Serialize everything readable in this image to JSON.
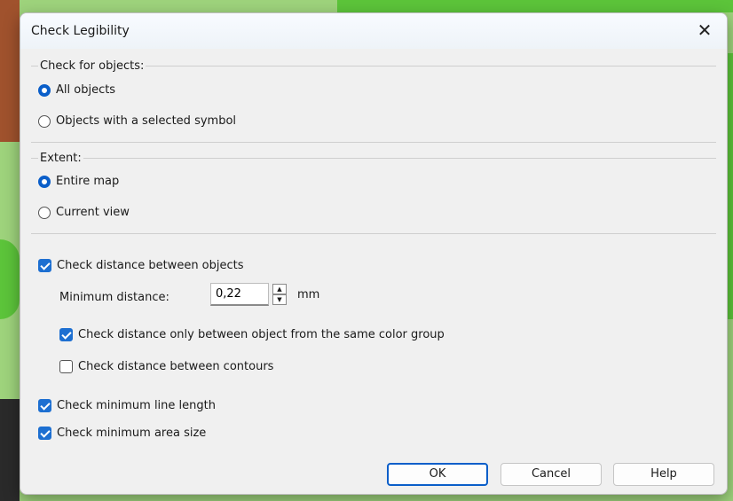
{
  "dialog": {
    "title": "Check Legibility",
    "close_glyph": "✕"
  },
  "check_for": {
    "label": "Check for objects:",
    "options": [
      "All objects",
      "Objects with a selected symbol"
    ],
    "selected": 0
  },
  "extent": {
    "label": "Extent:",
    "options": [
      "Entire map",
      "Current view"
    ],
    "selected": 0
  },
  "distance": {
    "check_label": "Check distance between objects",
    "checked": true,
    "min_label": "Minimum distance:",
    "min_value": "0,22",
    "unit": "mm",
    "same_color_label": "Check distance only between object from the same color group",
    "same_color_checked": true,
    "contours_label": "Check distance between contours",
    "contours_checked": false
  },
  "line_length": {
    "label": "Check minimum line length",
    "checked": true
  },
  "area_size": {
    "label": "Check minimum area size",
    "checked": true
  },
  "buttons": {
    "ok": "OK",
    "cancel": "Cancel",
    "help": "Help"
  },
  "colors": {
    "accent": "#0a5ec9",
    "map_green": "#5cc43a",
    "map_brown": "#a0522d"
  }
}
